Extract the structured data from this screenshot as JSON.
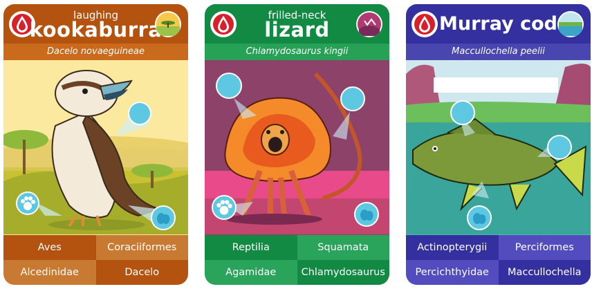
{
  "cards": [
    {
      "name_small": "laughing",
      "name_large": "kookaburra",
      "scientific": "Dacelo novaeguineae",
      "taxonomy": [
        "Aves",
        "Coraciiformes",
        "Alcedinidae",
        "Dacelo"
      ],
      "colors": {
        "header": "#b4520f",
        "sci_bar": "#c96a1d",
        "bg": "#fbe9a0",
        "tax_dark": "#b4520f",
        "tax_light": "#c97a32"
      },
      "icons": [
        "blood-drop-icon",
        "savanna-habitat-icon",
        "feather-icon",
        "paw-icon",
        "egg-icon"
      ]
    },
    {
      "name_small": "frilled-neck",
      "name_large": "lizard",
      "scientific": "Chlamydosaurus kingii",
      "taxonomy": [
        "Reptilia",
        "Squamata",
        "Agamidae",
        "Chlamydosaurus"
      ],
      "colors": {
        "header": "#138a44",
        "sci_bar": "#27a155",
        "bg": "#8d4269",
        "tax_dark": "#138a44",
        "tax_light": "#2aa45a"
      },
      "icons": [
        "blood-drop-icon",
        "desert-habitat-icon",
        "scales-icon",
        "paw-icon",
        "egg-icon"
      ]
    },
    {
      "name_small": "",
      "name_large": "Murray cod",
      "scientific": "Maccullochella peelii",
      "taxonomy": [
        "Actinopterygii",
        "Perciformes",
        "Percichthyidae",
        "Maccullochella"
      ],
      "colors": {
        "header": "#3530a0",
        "sci_bar": "#4a46b0",
        "bg": "#4bb8a8",
        "tax_dark": "#3530a0",
        "tax_light": "#524cbf"
      },
      "icons": [
        "blood-drop-icon",
        "river-habitat-icon",
        "scales-icon",
        "egg-icon"
      ]
    }
  ]
}
